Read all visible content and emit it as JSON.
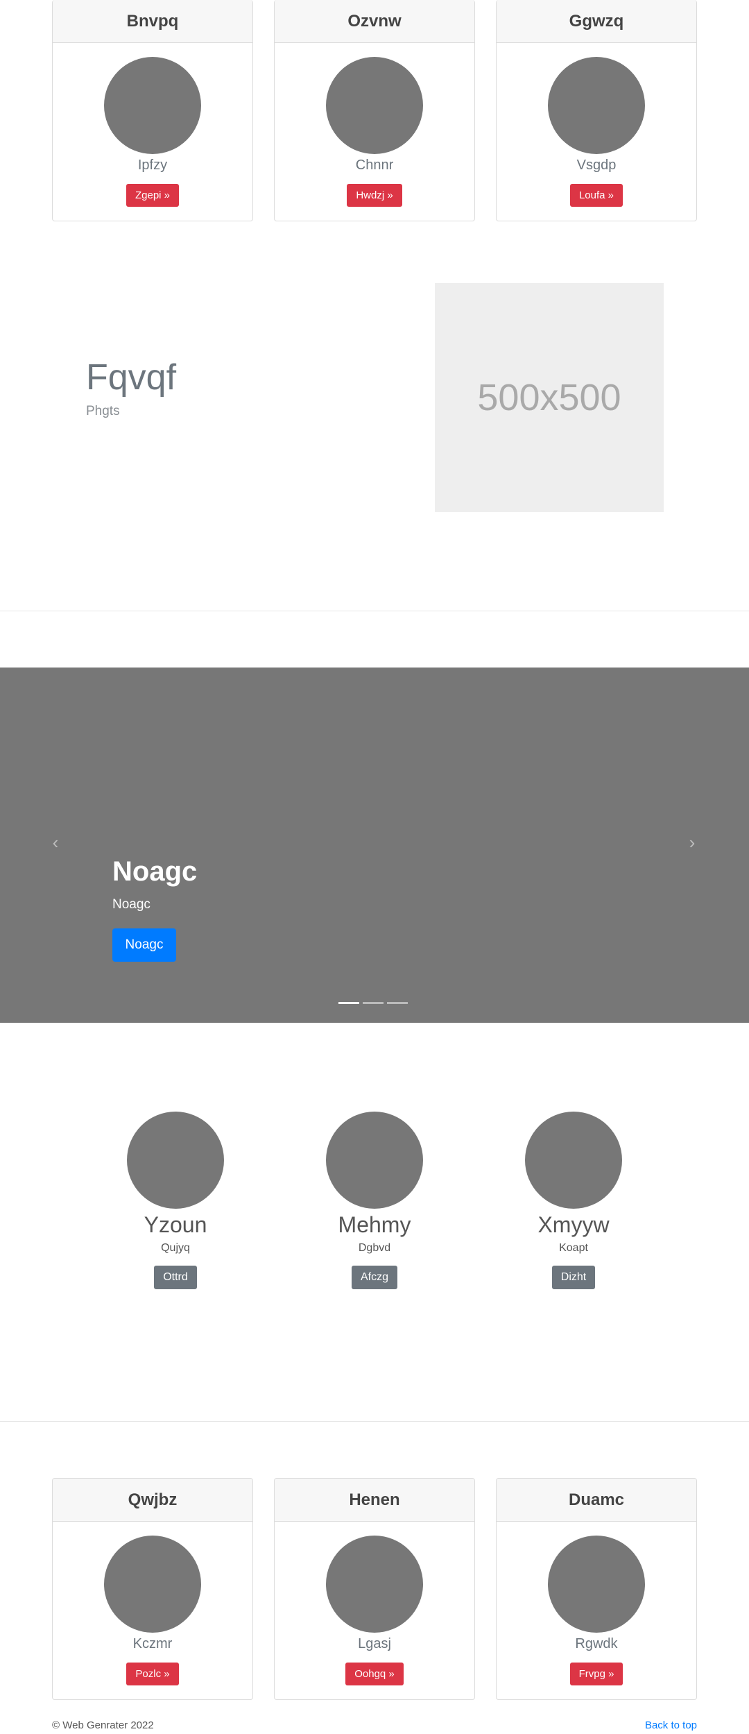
{
  "top_cards": [
    {
      "title": "Bnvpq",
      "subtitle": "Ipfzy",
      "button": "Zgepi »"
    },
    {
      "title": "Ozvnw",
      "subtitle": "Chnnr",
      "button": "Hwdzj »"
    },
    {
      "title": "Ggwzq",
      "subtitle": "Vsgdp",
      "button": "Loufa »"
    }
  ],
  "feature": {
    "title": "Fqvqf",
    "subtitle": "Phgts",
    "image_label": "500x500"
  },
  "carousel": {
    "prev_icon": "‹",
    "next_icon": "›",
    "title": "Noagc",
    "subtitle": "Noagc",
    "button": "Noagc",
    "active_slide": 1,
    "slide_count": 3
  },
  "team": [
    {
      "name": "Yzoun",
      "role": "Qujyq",
      "button": "Ottrd"
    },
    {
      "name": "Mehmy",
      "role": "Dgbvd",
      "button": "Afczg"
    },
    {
      "name": "Xmyyw",
      "role": "Koapt",
      "button": "Dizht"
    }
  ],
  "bottom_cards": [
    {
      "title": "Qwjbz",
      "subtitle": "Kczmr",
      "button": "Pozlc »"
    },
    {
      "title": "Henen",
      "subtitle": "Lgasj",
      "button": "Oohgq »"
    },
    {
      "title": "Duamc",
      "subtitle": "Rgwdk",
      "button": "Frvpg »"
    }
  ],
  "footer": {
    "copyright": "© Web Genrater 2022",
    "back_to_top": "Back to top"
  },
  "colors": {
    "danger": "#dc3545",
    "primary": "#007bff",
    "secondary": "#6c757d",
    "placeholder_gray": "#777777"
  }
}
